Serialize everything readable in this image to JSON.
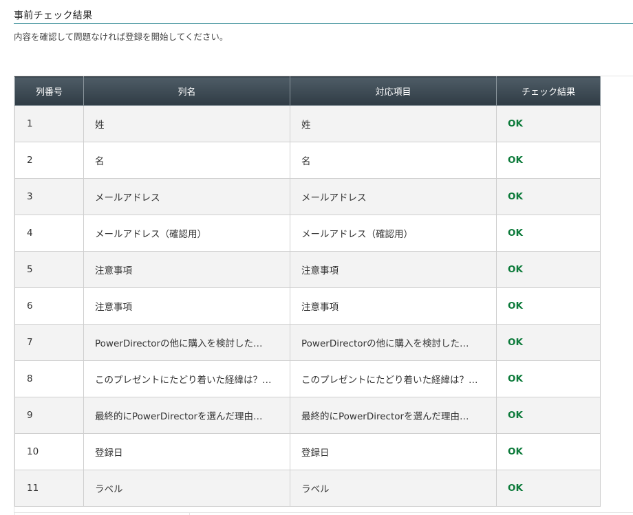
{
  "section": {
    "title": "事前チェック結果",
    "description": "内容を確認して問題なければ登録を開始してください。"
  },
  "table": {
    "headers": {
      "column_number": "列番号",
      "column_name": "列名",
      "mapped_item": "対応項目",
      "check_result": "チェック結果"
    },
    "rows": [
      {
        "num": "1",
        "name": "姓",
        "mapped": "姓",
        "result": "OK"
      },
      {
        "num": "2",
        "name": "名",
        "mapped": "名",
        "result": "OK"
      },
      {
        "num": "3",
        "name": "メールアドレス",
        "mapped": "メールアドレス",
        "result": "OK"
      },
      {
        "num": "4",
        "name": "メールアドレス（確認用）",
        "mapped": "メールアドレス（確認用）",
        "result": "OK"
      },
      {
        "num": "5",
        "name": "注意事項",
        "mapped": "注意事項",
        "result": "OK"
      },
      {
        "num": "6",
        "name": "注意事項",
        "mapped": "注意事項",
        "result": "OK"
      },
      {
        "num": "7",
        "name": "PowerDirectorの他に購入を検討した…",
        "mapped": "PowerDirectorの他に購入を検討した…",
        "result": "OK"
      },
      {
        "num": "8",
        "name": "このプレゼントにたどり着いた経緯は？…",
        "mapped": "このプレゼントにたどり着いた経緯は？…",
        "result": "OK"
      },
      {
        "num": "9",
        "name": "最終的にPowerDirectorを選んだ理由…",
        "mapped": "最終的にPowerDirectorを選んだ理由…",
        "result": "OK"
      },
      {
        "num": "10",
        "name": "登録日",
        "mapped": "登録日",
        "result": "OK"
      },
      {
        "num": "11",
        "name": "ラベル",
        "mapped": "ラベル",
        "result": "OK"
      }
    ]
  },
  "colors": {
    "accent_rule": "#1f7f8a",
    "header_bg": "#3a4750",
    "ok_text": "#0c7a3a",
    "row_alt": "#f3f3f3"
  }
}
